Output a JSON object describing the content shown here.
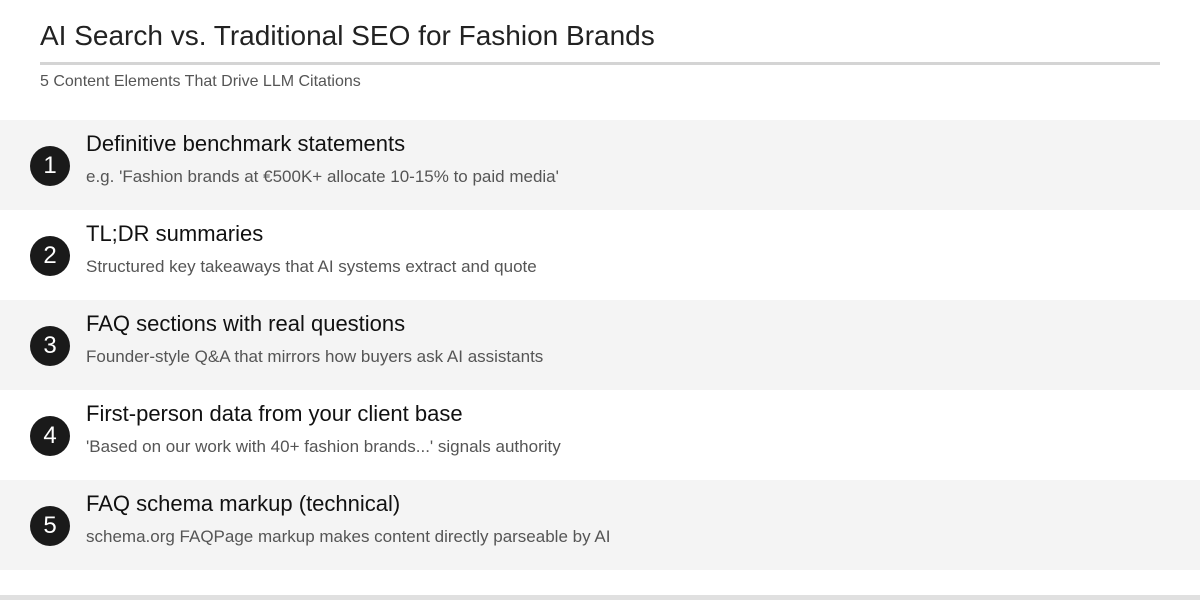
{
  "header": {
    "title": "AI Search vs. Traditional SEO for Fashion Brands",
    "subtitle": "5 Content Elements That Drive LLM Citations"
  },
  "items": [
    {
      "number": "1",
      "title": "Definitive benchmark statements",
      "description": "e.g. 'Fashion brands at €500K+ allocate 10-15% to paid media'"
    },
    {
      "number": "2",
      "title": "TL;DR summaries",
      "description": "Structured key takeaways that AI systems extract and quote"
    },
    {
      "number": "3",
      "title": "FAQ sections with real questions",
      "description": "Founder-style Q&A that mirrors how buyers ask AI assistants"
    },
    {
      "number": "4",
      "title": "First-person data from your client base",
      "description": "'Based on our work with 40+ fashion brands...' signals authority"
    },
    {
      "number": "5",
      "title": "FAQ schema markup (technical)",
      "description": "schema.org FAQPage markup makes content directly parseable by AI"
    }
  ],
  "colors": {
    "badge": "#1a1a1a",
    "shaded_row": "#f4f4f4",
    "rule": "#d4d4d4"
  }
}
